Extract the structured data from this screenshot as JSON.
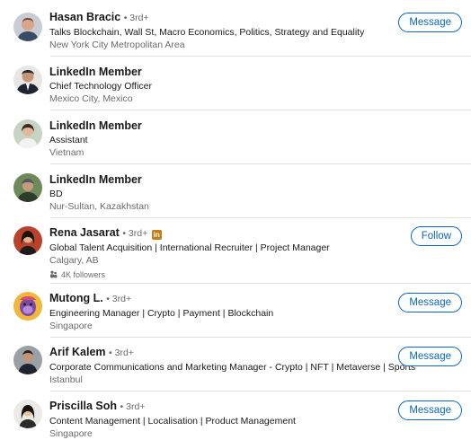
{
  "people": [
    {
      "name": "Hasan Bracic",
      "degree": "• 3rd+",
      "headline": "Talks Blockchain, Wall St, Macro Economics, Politics, Strategy and Equality",
      "location": "New York City Metropolitan Area",
      "action": "Message",
      "avatar_icon": "person-avatar-icon"
    },
    {
      "name": "LinkedIn Member",
      "degree": "",
      "headline": "Chief Technology Officer",
      "location": "Mexico City, Mexico",
      "action": "",
      "avatar_icon": "person-avatar-icon"
    },
    {
      "name": "LinkedIn Member",
      "degree": "",
      "headline": "Assistant",
      "location": "Vietnam",
      "action": "",
      "avatar_icon": "person-avatar-icon"
    },
    {
      "name": "LinkedIn Member",
      "degree": "",
      "headline": "BD",
      "location": "Nur-Sultan, Kazakhstan",
      "action": "",
      "avatar_icon": "person-avatar-icon"
    },
    {
      "name": "Rena Jasarat",
      "degree": "• 3rd+",
      "badge": "in",
      "headline": "Global Talent Acquisition | International Recruiter | Project Manager",
      "location": "Calgary, AB",
      "followers": "4K followers",
      "action": "Follow",
      "avatar_icon": "person-avatar-icon"
    },
    {
      "name": "Mutong L.",
      "degree": "• 3rd+",
      "headline": "Engineering Manager | Crypto | Payment | Blockchain",
      "location": "Singapore",
      "action": "Message",
      "avatar_icon": "ape-avatar-icon"
    },
    {
      "name": "Arif Kalem",
      "degree": "• 3rd+",
      "headline": "Corporate Communications and Marketing Manager - Crypto | NFT | Metaverse | Sports",
      "location": "Istanbul",
      "action": "Message",
      "avatar_icon": "person-avatar-icon"
    },
    {
      "name": "Priscilla Soh",
      "degree": "• 3rd+",
      "headline": "Content Management | Localisation | Product Management",
      "location": "Singapore",
      "action": "Message",
      "avatar_icon": "person-avatar-icon"
    }
  ],
  "colors": {
    "accent": "#0a66c2",
    "badge": "#c37d16",
    "separator": "#e0dfdc"
  }
}
